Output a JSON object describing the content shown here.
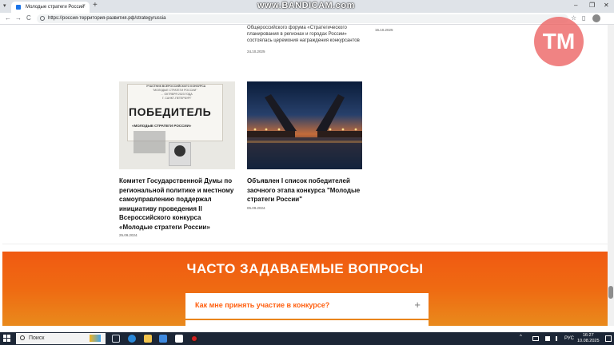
{
  "browser": {
    "tab_title": "Молодые стратеги России",
    "tab_close": "×",
    "new_tab": "+",
    "url": "https://россия-территория-развития.рф/strategyrussia",
    "back": "←",
    "forward": "→",
    "reload": "C",
    "win_minimize": "–",
    "win_maximize": "❐",
    "win_close": "✕",
    "star": "☆",
    "sidepanel": "▯"
  },
  "watermark": "www.BANDICAM.com",
  "logo_text": "TM",
  "prev_news": {
    "left_lines": [
      "Общероссийского форума «Стратегического",
      "планирования в регионах и городах России»",
      "состоялась церемония награждения конкурсантов"
    ],
    "left_date": "24.10.2025",
    "right_date": "16.10.2025"
  },
  "news": [
    {
      "title_lines": [
        "Комитет Государственной Думы по",
        "региональной политике и местному",
        "самоуправлению поддержал",
        "инициативу проведения II",
        "Всероссийского конкурса",
        "«Молодые стратеги России»"
      ],
      "date": "25.09.2024",
      "image": {
        "caption_1": "УЧАСТНИК ВСЕРОССИЙСКОГО КОНКУРСА",
        "caption_2": "\"МОЛОДЫЕ СТРАТЕГИ РОССИИ\"",
        "caption_3": "… ОКТЯБРЯ 2023 ГОДА",
        "caption_4": "Г. САНКТ-ПЕТЕРБУРГ",
        "winner": "ПОБЕДИТЕЛЬ",
        "contest": "«МОЛОДЫЕ СТРАТЕГИ РОССИИ»"
      }
    },
    {
      "title_lines": [
        "Объявлен I список победителей",
        "заочного этапа конкурса \"Молодые",
        "стратеги России\""
      ],
      "date": "05.09.2024"
    }
  ],
  "faq": {
    "heading": "ЧАСТО ЗАДАВАЕМЫЕ ВОПРОСЫ",
    "items": [
      {
        "question": "Как мне принять участие в конкурсе?",
        "icon": "+"
      }
    ]
  },
  "taskbar": {
    "search_placeholder": "Поиск",
    "tray_chevron": "^",
    "tray_lang": "РУС",
    "clock_time": "16:27",
    "clock_date": "10.08.2025"
  }
}
